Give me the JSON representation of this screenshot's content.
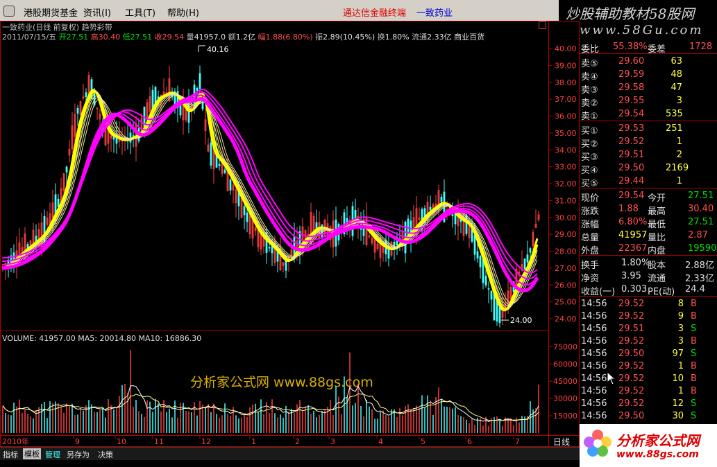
{
  "menubar": {
    "items": [
      "港股期货基金",
      "资讯(I)",
      "工具(T)",
      "帮助(H)"
    ],
    "link_red": "通达信金融终端",
    "link_blue": "一致药业"
  },
  "banner": {
    "line1": "炒股辅助教材58股网",
    "line2": "www.58Gu.com"
  },
  "chart_header": {
    "title": "一致药业(日线 前复权) 趋势彩带",
    "date": "2011/07/15/五",
    "open_label": "开",
    "open": "27.51",
    "high_label": "高",
    "high": "30.40",
    "low_label": "低",
    "low": "27.51",
    "close_label": "收",
    "close": "29.54",
    "vol_label": "量",
    "vol": "41957.0",
    "amount_label": "额",
    "amount": "1.2亿",
    "change_label": "幅",
    "change": "1.88(6.80%)",
    "amplitude_label": "振",
    "amplitude": "2.89(10.45%)",
    "turnover_label": "换",
    "turnover": "1.80%",
    "float_label": "流通",
    "float": "2.33亿",
    "industry": "商业百货"
  },
  "annotations": {
    "high_marker": "40.16",
    "low_marker": "24.00"
  },
  "price_axis": [
    "40.00",
    "39.00",
    "38.00",
    "37.00",
    "36.00",
    "35.00",
    "34.00",
    "33.00",
    "32.00",
    "31.00",
    "30.00",
    "29.00",
    "28.00",
    "27.00",
    "26.00",
    "25.00",
    "24.00"
  ],
  "volume_header": {
    "label": "VOLUME:",
    "value": "41957.00",
    "ma5_label": "MA5:",
    "ma5": "20014.80",
    "ma10_label": "MA10:",
    "ma10": "16886.30"
  },
  "volume_axis": [
    "75000",
    "60000",
    "45000",
    "30000",
    "15000"
  ],
  "x_axis": [
    "2010年",
    "9",
    "10",
    "11",
    "12",
    "1",
    "2",
    "3",
    "4",
    "5",
    "6",
    "7"
  ],
  "period": "日线",
  "watermark": "分析家公式网 www.88gs.com",
  "bottom_tabs": [
    "指标",
    "模板",
    "管理",
    "另存为",
    "决策"
  ],
  "side_panel": {
    "ratio_row": {
      "l1": "委比",
      "v1": "55.38%",
      "l2": "委差",
      "v2": "1728"
    },
    "asks": [
      {
        "label": "卖⑤",
        "price": "29.60",
        "vol": "63"
      },
      {
        "label": "卖④",
        "price": "29.59",
        "vol": "48"
      },
      {
        "label": "卖③",
        "price": "29.58",
        "vol": "47"
      },
      {
        "label": "卖②",
        "price": "29.55",
        "vol": "3"
      },
      {
        "label": "卖①",
        "price": "29.54",
        "vol": "535"
      }
    ],
    "bids": [
      {
        "label": "买①",
        "price": "29.53",
        "vol": "251"
      },
      {
        "label": "买②",
        "price": "29.52",
        "vol": "1"
      },
      {
        "label": "买③",
        "price": "29.51",
        "vol": "2"
      },
      {
        "label": "买④",
        "price": "29.50",
        "vol": "2169"
      },
      {
        "label": "买⑤",
        "price": "29.44",
        "vol": "1"
      }
    ],
    "stats1": [
      {
        "l1": "现价",
        "v1": "29.54",
        "l2": "今开",
        "v2": "27.51",
        "c1": "#ff5050",
        "c2": "#00e000"
      },
      {
        "l1": "涨跌",
        "v1": "1.88",
        "l2": "最高",
        "v2": "30.40",
        "c1": "#ff5050",
        "c2": "#ff5050"
      },
      {
        "l1": "涨幅",
        "v1": "6.80%",
        "l2": "最低",
        "v2": "27.51",
        "c1": "#ff5050",
        "c2": "#00e000"
      },
      {
        "l1": "总量",
        "v1": "41957",
        "l2": "量比",
        "v2": "2.87",
        "c1": "#ffff40",
        "c2": "#ff5050"
      },
      {
        "l1": "外盘",
        "v1": "22367",
        "l2": "内盘",
        "v2": "19590",
        "c1": "#ff5050",
        "c2": "#00e000"
      }
    ],
    "stats2": [
      {
        "l1": "换手",
        "v1": "1.80%",
        "l2": "股本",
        "v2": "2.88亿"
      },
      {
        "l1": "净资",
        "v1": "3.95",
        "l2": "流通",
        "v2": "2.33亿"
      },
      {
        "l1": "收益(一)",
        "v1": "0.303",
        "l2": "PE(动)",
        "v2": "24.4"
      }
    ],
    "ticks": [
      {
        "time": "14:56",
        "price": "29.52",
        "vol": "8",
        "side": "B"
      },
      {
        "time": "14:56",
        "price": "29.52",
        "vol": "9",
        "side": "B"
      },
      {
        "time": "14:56",
        "price": "29.51",
        "vol": "3",
        "side": "S"
      },
      {
        "time": "14:56",
        "price": "29.52",
        "vol": "3",
        "side": "B"
      },
      {
        "time": "14:56",
        "price": "29.50",
        "vol": "97",
        "side": "S"
      },
      {
        "time": "14:56",
        "price": "29.52",
        "vol": "1",
        "side": "B"
      },
      {
        "time": "14:56",
        "price": "29.52",
        "vol": "10",
        "side": "B"
      },
      {
        "time": "14:56",
        "price": "29.52",
        "vol": "1",
        "side": "B"
      },
      {
        "time": "14:56",
        "price": "29.52",
        "vol": "12",
        "side": "S"
      },
      {
        "time": "14:56",
        "price": "29.50",
        "vol": "30",
        "side": "S"
      }
    ]
  },
  "logo": {
    "line1": "分析家公式网",
    "line2": "www.88gs.com"
  },
  "colors": {
    "up": "#ff5050",
    "down": "#00e000",
    "ribbon_yellow": "#ffff00",
    "ribbon_magenta": "#ff00ff",
    "grid_red": "#b00000"
  }
}
